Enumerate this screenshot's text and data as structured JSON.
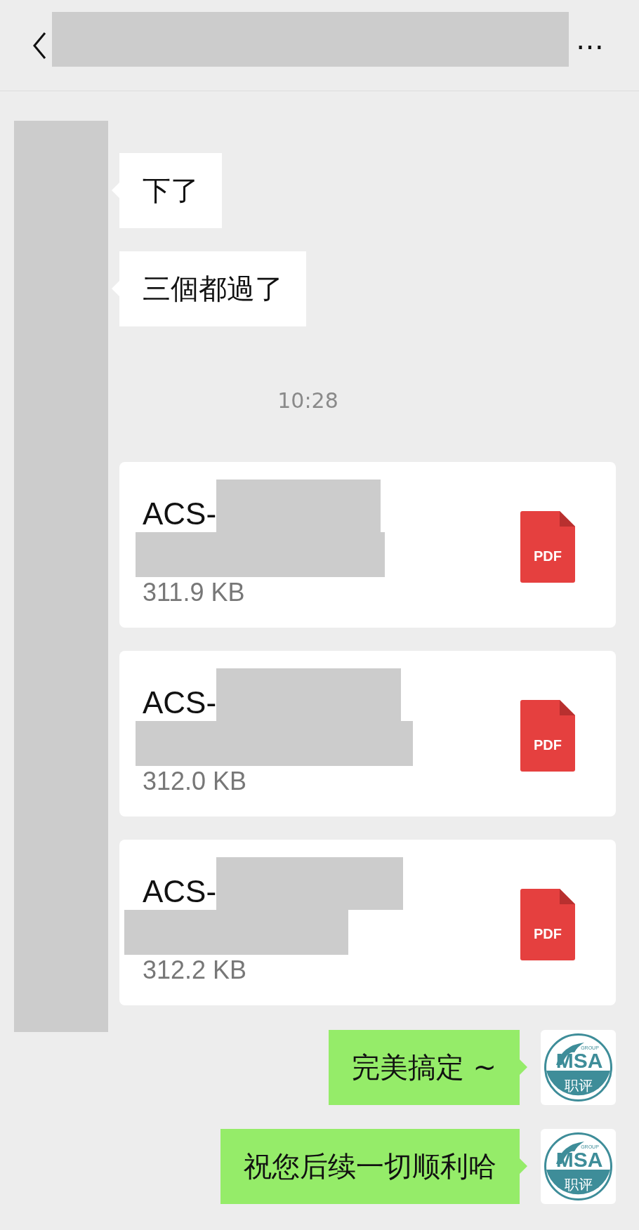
{
  "header": {
    "more": "…"
  },
  "incoming": [
    {
      "text": "下了"
    },
    {
      "text": "三個都過了"
    }
  ],
  "time": "10:28",
  "files": [
    {
      "name": "ACS-",
      "size": "311.9 KB",
      "type": "PDF"
    },
    {
      "name": "ACS-",
      "size": "312.0 KB",
      "type": "PDF"
    },
    {
      "name": "ACS-",
      "size": "312.2 KB",
      "type": "PDF"
    }
  ],
  "outgoing": [
    {
      "text": "完美搞定 ~",
      "avatar": {
        "logo": "MSA",
        "group": "GROUP",
        "caption": "职评"
      }
    },
    {
      "text": "祝您后续一切顺利哈",
      "avatar": {
        "logo": "MSA",
        "group": "GROUP",
        "caption": "职评"
      }
    }
  ]
}
